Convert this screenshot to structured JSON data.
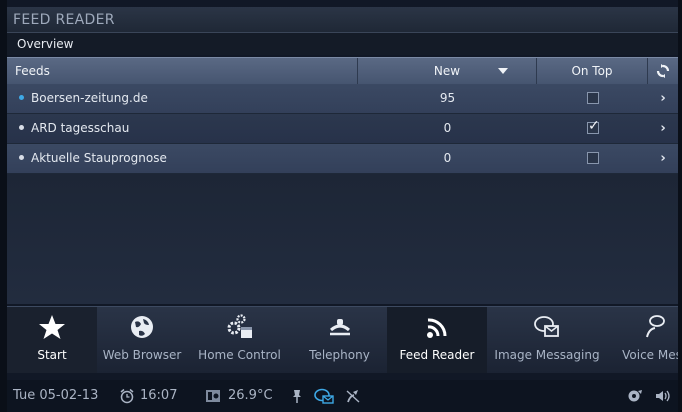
{
  "app": {
    "title": "FEED READER",
    "section": "Overview"
  },
  "table": {
    "headers": {
      "feeds": "Feeds",
      "new": "New",
      "on_top": "On Top"
    },
    "rows": [
      {
        "name": "Boersen-zeitung.de",
        "new": "95",
        "on_top": false,
        "bullet_color": "#3ea9e6"
      },
      {
        "name": "ARD tagesschau",
        "new": "0",
        "on_top": true,
        "bullet_color": "#d8dde6"
      },
      {
        "name": "Aktuelle Stauprognose",
        "new": "0",
        "on_top": false,
        "bullet_color": "#d8dde6"
      }
    ]
  },
  "dock": {
    "items": [
      {
        "label": "Start",
        "icon": "star-icon"
      },
      {
        "label": "Web Browser",
        "icon": "globe-icon"
      },
      {
        "label": "Home Control",
        "icon": "gears-calendar-icon"
      },
      {
        "label": "Telephony",
        "icon": "telephone-icon"
      },
      {
        "label": "Feed Reader",
        "icon": "rss-icon"
      },
      {
        "label": "Image Messaging",
        "icon": "image-message-icon"
      },
      {
        "label": "Voice Mes",
        "icon": "voice-message-icon"
      }
    ]
  },
  "status": {
    "date": "Tue 05-02-13",
    "time": "16:07",
    "temperature": "26.9°C"
  },
  "colors": {
    "accent": "#3ea9e6",
    "header_bg": "#4e5d78",
    "row_odd": "#3b4963",
    "row_even": "#2c384e"
  }
}
